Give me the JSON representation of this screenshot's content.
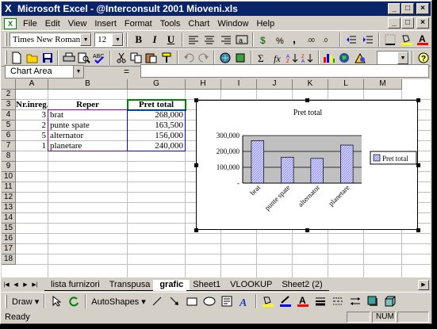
{
  "window": {
    "title": "Microsoft Excel - @Interconsult 2001 Mioveni.xls",
    "caption_buttons": [
      "_",
      "□",
      "×"
    ]
  },
  "menu": {
    "items": [
      "File",
      "Edit",
      "View",
      "Insert",
      "Format",
      "Tools",
      "Chart",
      "Window",
      "Help"
    ]
  },
  "formatting_toolbar": {
    "font": "Times New Roman",
    "size": "12",
    "bold": "B",
    "italic": "I",
    "underline": "U"
  },
  "formula_bar": {
    "name_box": "Chart Area",
    "equals": "=",
    "formula": ""
  },
  "sheet": {
    "columns": [
      "A",
      "B",
      "G",
      "H",
      "I",
      "J",
      "K",
      "L",
      "M"
    ],
    "rows": [
      "2",
      "3",
      "4",
      "5",
      "6",
      "7",
      "8",
      "9",
      "10",
      "11",
      "12",
      "13",
      "14",
      "15",
      "16",
      "17",
      "18"
    ],
    "header": {
      "a": "Nr.inreg.",
      "b": "Reper",
      "g": "Pret total"
    },
    "data": [
      {
        "a": "3",
        "b": "brat",
        "g": "268,000"
      },
      {
        "a": "2",
        "b": "punte spate",
        "g": "163,500"
      },
      {
        "a": "5",
        "b": "alternator",
        "g": "156,000"
      },
      {
        "a": "1",
        "b": "planetare",
        "g": "240,000"
      }
    ]
  },
  "chart_data": {
    "type": "bar",
    "title": "Pret total",
    "categories": [
      "brat",
      "punte spate",
      "alternator",
      "planetare"
    ],
    "series": [
      {
        "name": "Pret total",
        "values": [
          268000,
          163500,
          156000,
          240000
        ]
      }
    ],
    "ylim": [
      0,
      300000
    ],
    "yticks": [
      "-",
      "100,000",
      "200,000",
      "300,000"
    ],
    "legend": "right",
    "grid": true,
    "colors": {
      "bar": "#9999ff",
      "plot_bg": "#c0c0c0"
    }
  },
  "tabs": {
    "items": [
      "lista furnizori",
      "Transpusa",
      "grafic",
      "Sheet1",
      "VLOOKUP",
      "Sheet2 (2)"
    ],
    "active": "grafic"
  },
  "drawing_toolbar": {
    "draw": "Draw",
    "autoshapes": "AutoShapes"
  },
  "status": {
    "text": "Ready",
    "num": "NUM"
  }
}
